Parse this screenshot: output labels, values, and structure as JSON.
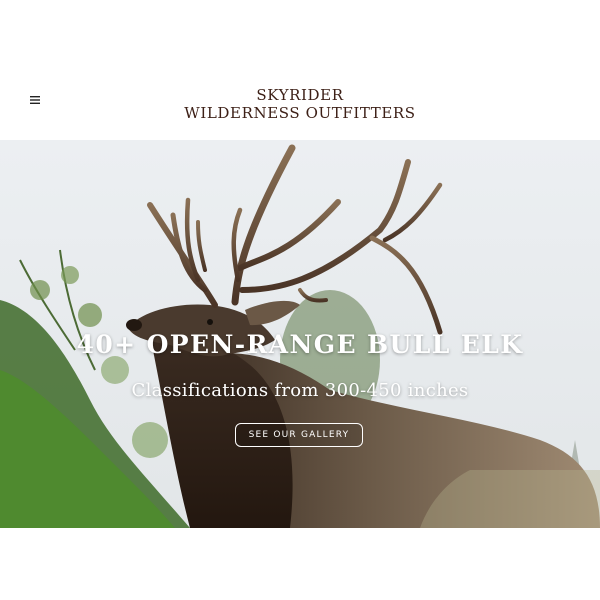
{
  "header": {
    "brand_line1": "SKYRIDER",
    "brand_line2": "WILDERNESS OUTFITTERS",
    "menu_icon": "hamburger-menu-icon"
  },
  "hero": {
    "title": "40+ OPEN-RANGE BULL ELK",
    "subtitle": "Classifications from 300-450 inches",
    "cta_label": "SEE OUR GALLERY",
    "image_subject": "bull-elk-photo"
  },
  "colors": {
    "brand_text": "#3d2017",
    "hero_text": "#ffffff",
    "page_background": "#ffffff"
  }
}
